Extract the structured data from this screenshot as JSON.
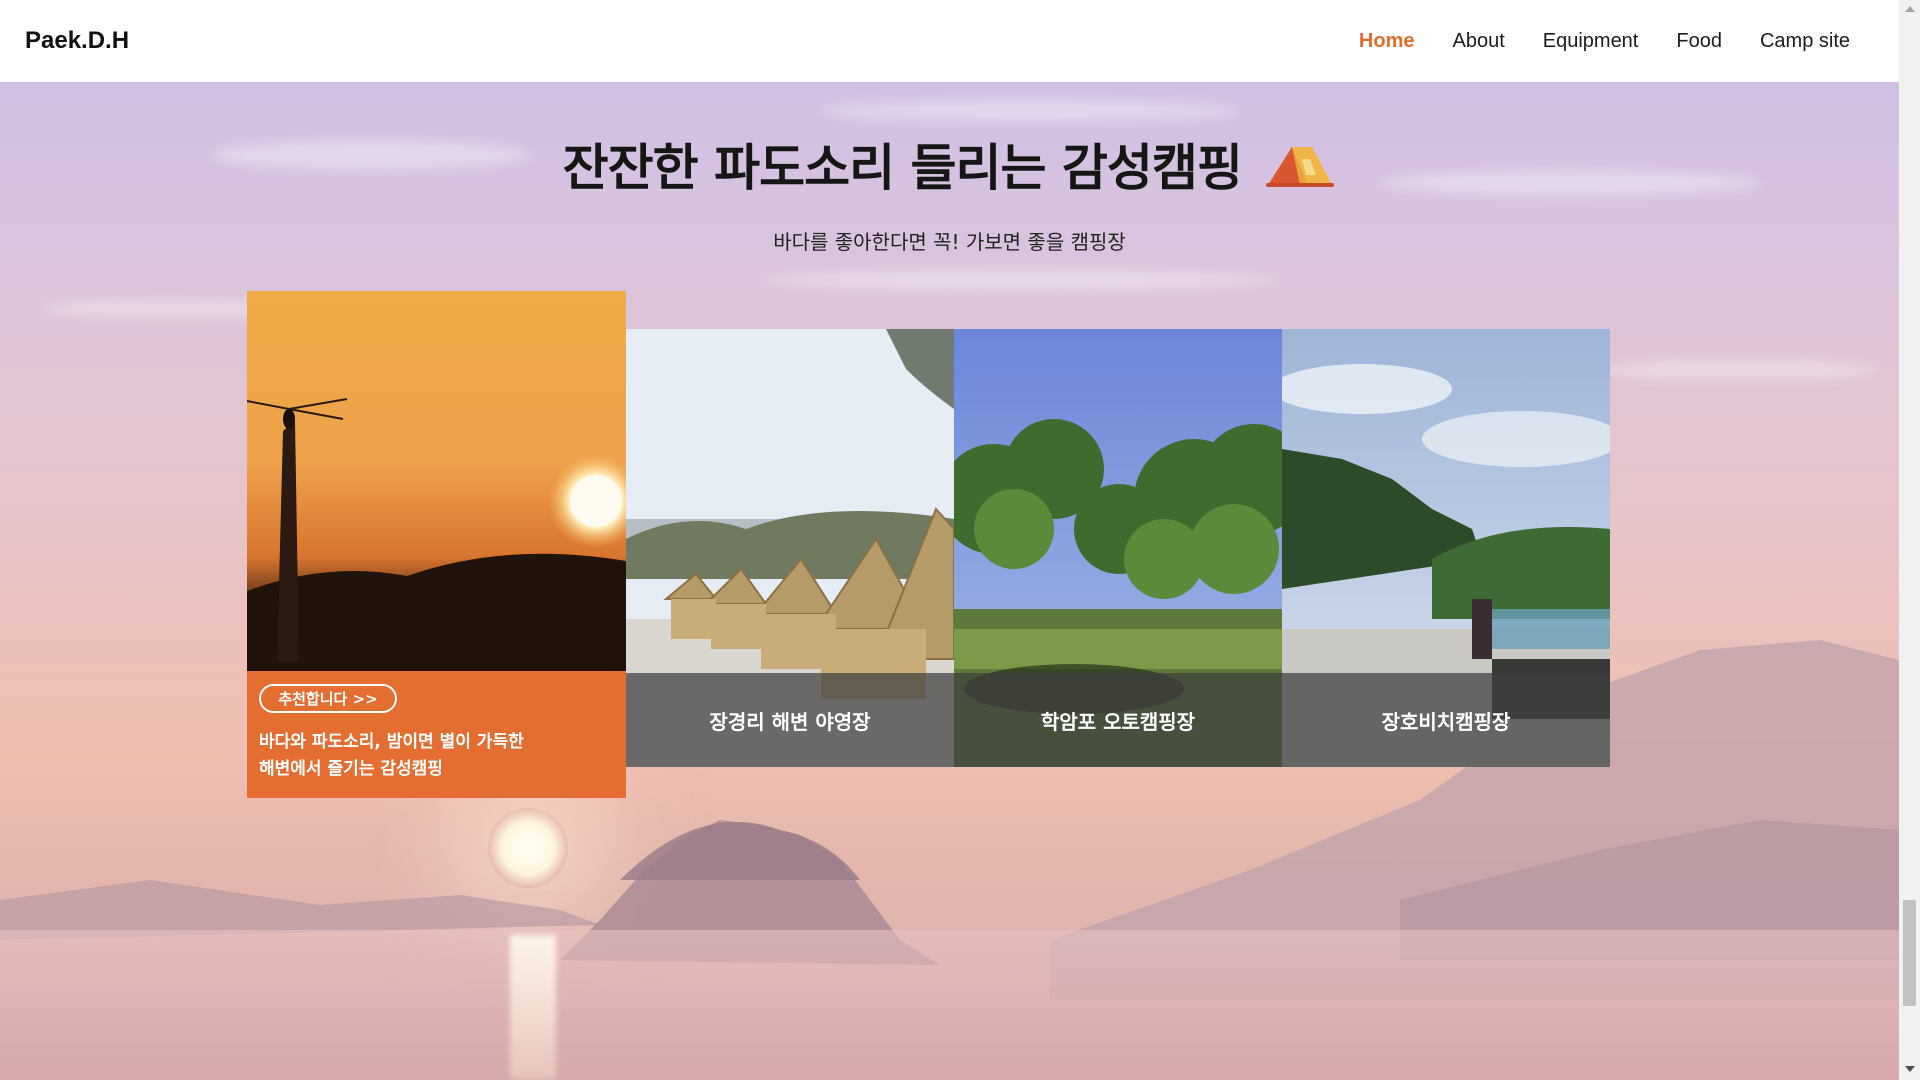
{
  "header": {
    "brand": "Paek.D.H",
    "nav": [
      {
        "label": "Home",
        "active": true
      },
      {
        "label": "About",
        "active": false
      },
      {
        "label": "Equipment",
        "active": false
      },
      {
        "label": "Food",
        "active": false
      },
      {
        "label": "Camp site",
        "active": false
      }
    ]
  },
  "hero": {
    "title": "잔잔한 파도소리 들리는 감성캠핑",
    "title_icon": "tent-icon",
    "subtitle": "바다를 좋아한다면 꼭! 가보면 좋을 캠핑장"
  },
  "feature": {
    "badge": "추천합니다 >>",
    "description_line1": "바다와 파도소리, 밤이면 별이 가득한",
    "description_line2": "해변에서 즐기는 감성캠핑",
    "photo": "sunset-dragonfly-photo"
  },
  "cards": [
    {
      "label": "장경리 해변 야영장",
      "photo": "beach-cabins-photo"
    },
    {
      "label": "학암포 오토캠핑장",
      "photo": "trees-campground-photo"
    },
    {
      "label": "장호비치캠핑장",
      "photo": "beach-campsite-photo"
    }
  ],
  "colors": {
    "accent": "#e36c2c",
    "feature_bg": "#e46d32",
    "card_label_bg": "#3e3e3e"
  }
}
